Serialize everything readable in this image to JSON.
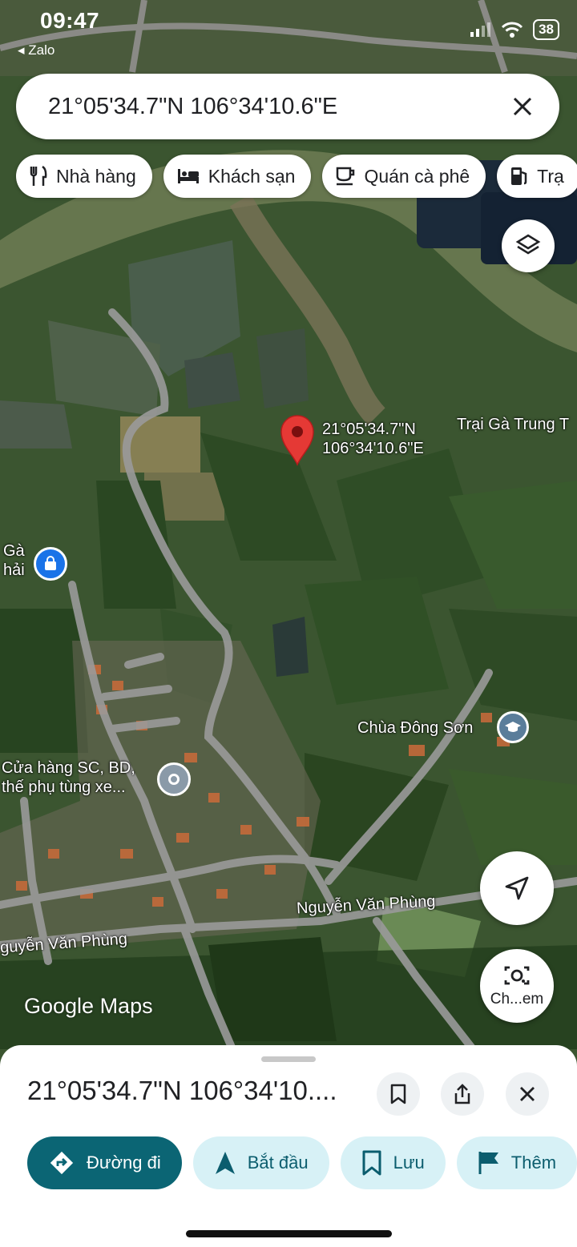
{
  "status": {
    "time": "09:47",
    "back_app": "◂ Zalo",
    "battery": "38"
  },
  "search": {
    "query": "21°05'34.7\"N 106°34'10.6\"E"
  },
  "chips": [
    {
      "label": "Nhà hàng",
      "icon": "fork-knife-icon"
    },
    {
      "label": "Khách sạn",
      "icon": "bed-icon"
    },
    {
      "label": "Quán cà phê",
      "icon": "coffee-cup-icon"
    },
    {
      "label": "Trạ",
      "icon": "gas-station-icon"
    }
  ],
  "map": {
    "pin_lat": "21°05'34.7\"N",
    "pin_lng": "106°34'10.6\"E",
    "place_trai_ga": "Trại Gà Trung T",
    "place_ga_1": "Gà",
    "place_ga_2": "hải",
    "place_chua": "Chùa Đông Sơn",
    "place_shop_1": "Cửa hàng SC, BD,",
    "place_shop_2": "thế phụ tùng xe...",
    "road_1": "Nguyễn Văn Phùng",
    "road_2": "guyễn Văn Phùng",
    "watermark": "Google Maps",
    "camera_label": "Ch...em"
  },
  "sheet": {
    "title": "21°05'34.7\"N 106°34'10....",
    "actions": [
      {
        "label": "Đường đi",
        "icon": "directions-icon"
      },
      {
        "label": "Bắt đầu",
        "icon": "navigation-arrow-icon"
      },
      {
        "label": "Lưu",
        "icon": "bookmark-icon"
      },
      {
        "label": "Thêm",
        "icon": "flag-icon"
      }
    ]
  },
  "colors": {
    "accent": "#0b6574",
    "pin": "#e53935",
    "action_bg": "#d7f1f6"
  }
}
